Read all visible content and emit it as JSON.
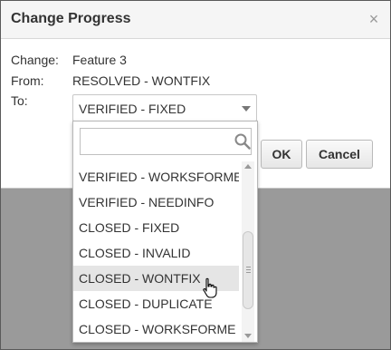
{
  "dialog": {
    "title": "Change Progress",
    "close_glyph": "×",
    "fields": {
      "change_label": "Change:",
      "change_value": "Feature 3",
      "from_label": "From:",
      "from_value": "RESOLVED - WONTFIX",
      "to_label": "To:"
    },
    "select": {
      "value": "VERIFIED - FIXED"
    },
    "buttons": {
      "ok": "OK",
      "cancel": "Cancel"
    }
  },
  "dropdown": {
    "search_placeholder": "",
    "options": [
      "VERIFIED - WORKSFORME",
      "VERIFIED - NEEDINFO",
      "CLOSED - FIXED",
      "CLOSED - INVALID",
      "CLOSED - WONTFIX",
      "CLOSED - DUPLICATE",
      "CLOSED - WORKSFORME"
    ],
    "highlighted": "CLOSED - WONTFIX"
  },
  "icons": {
    "close": "close-icon",
    "caret": "chevron-down-icon",
    "search": "search-icon",
    "cursor": "hand-pointer-icon"
  },
  "colors": {
    "overlay": "#9a9a9a",
    "highlight": "#e5e5e5",
    "title_bar": "#f5f5f5"
  }
}
